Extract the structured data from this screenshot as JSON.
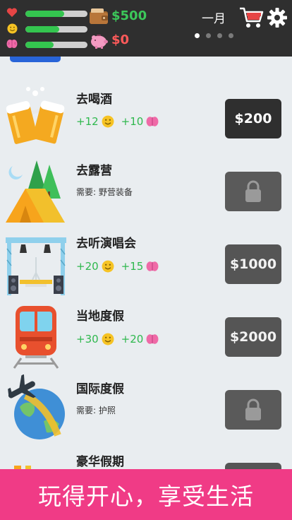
{
  "header": {
    "stats": [
      {
        "icon": "heart-icon",
        "level": 0.62,
        "color": "#e64545"
      },
      {
        "icon": "smiley-icon",
        "level": 0.55,
        "color": "#f6c324"
      },
      {
        "icon": "brain-icon",
        "level": 0.45,
        "color": "#ef6aa7"
      }
    ],
    "cash": "$500",
    "savings": "$0",
    "cash_color": "#3cc85a",
    "savings_color": "#ff5a5a",
    "month": "一月",
    "page_indicator": {
      "count": 4,
      "active": 0
    }
  },
  "items": [
    {
      "title": "去喝酒",
      "happiness": "+12",
      "brain": "+10",
      "price": "$200"
    },
    {
      "title": "去露营",
      "requirement": "需要: 野营装备"
    },
    {
      "title": "去听演唱会",
      "happiness": "+20",
      "brain": "+15",
      "price": "$1000"
    },
    {
      "title": "当地度假",
      "happiness": "+30",
      "brain": "+20",
      "price": "$2000"
    },
    {
      "title": "国际度假",
      "requirement": "需要: 护照"
    },
    {
      "title": "豪华假期"
    }
  ],
  "banner": {
    "text": "玩得开心，享受生活"
  },
  "colors": {
    "accent_green": "#34c54f",
    "banner_pink": "#f03b86",
    "header_bg": "#2f2f2f"
  }
}
